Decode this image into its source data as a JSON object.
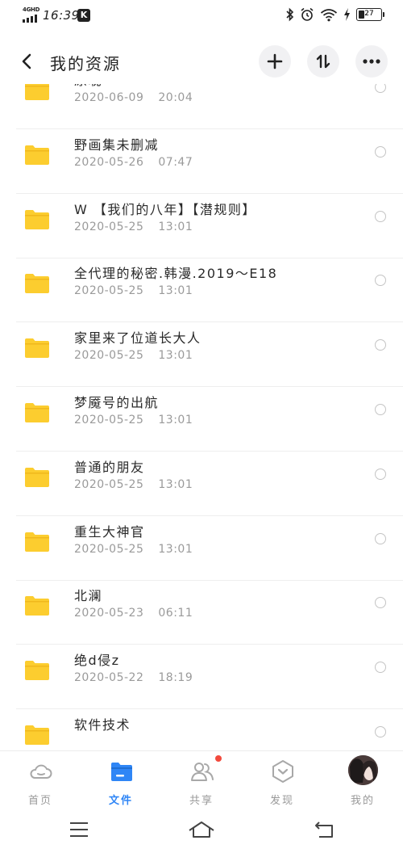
{
  "status_bar": {
    "network": "4GHD",
    "time": "16:39",
    "app_badge": "K",
    "battery_percent": 27,
    "icons": [
      "bluetooth-icon",
      "alarm-icon",
      "wifi-icon",
      "charging-icon",
      "battery-icon"
    ]
  },
  "header": {
    "title": "我的资源",
    "icons": [
      "back-icon",
      "plus-icon",
      "sort-icon",
      "more-icon"
    ]
  },
  "files": [
    {
      "name": "原耽",
      "date": "2020-06-09",
      "time": "20:04"
    },
    {
      "name": "野画集未删减",
      "date": "2020-05-26",
      "time": "07:47"
    },
    {
      "name": "W 【我们的八年】【潜规则】",
      "date": "2020-05-25",
      "time": "13:01"
    },
    {
      "name": "全代理的秘密.韩漫.2019～E18",
      "date": "2020-05-25",
      "time": "13:01"
    },
    {
      "name": "家里来了位道长大人",
      "date": "2020-05-25",
      "time": "13:01"
    },
    {
      "name": "梦魇号的出航",
      "date": "2020-05-25",
      "time": "13:01"
    },
    {
      "name": "普通的朋友",
      "date": "2020-05-25",
      "time": "13:01"
    },
    {
      "name": "重生大神官",
      "date": "2020-05-25",
      "time": "13:01"
    },
    {
      "name": "北澜",
      "date": "2020-05-23",
      "time": "06:11"
    },
    {
      "name": "绝d侵z",
      "date": "2020-05-22",
      "time": "18:19"
    },
    {
      "name": "软件技术",
      "date": "",
      "time": ""
    }
  ],
  "bottom_nav": [
    {
      "label": "首页",
      "icon": "cloud-icon",
      "active": false
    },
    {
      "label": "文件",
      "icon": "folder-icon",
      "active": true
    },
    {
      "label": "共享",
      "icon": "share-people-icon",
      "active": false,
      "has_badge": true
    },
    {
      "label": "发现",
      "icon": "discover-icon",
      "active": false
    },
    {
      "label": "我的",
      "icon": "avatar",
      "active": false
    }
  ],
  "colors": {
    "accent": "#2f86f6",
    "folder": "#fccd2f",
    "badge": "#f24a3d",
    "muted": "#9a9a9a"
  }
}
